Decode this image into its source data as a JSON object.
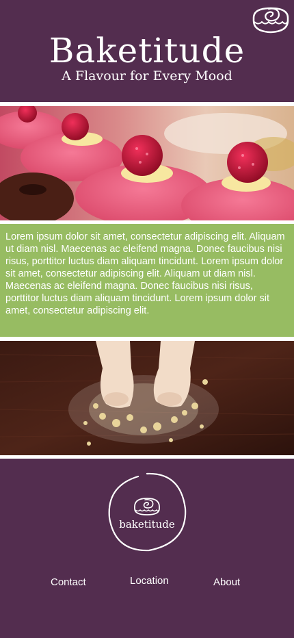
{
  "header": {
    "title": "Baketitude",
    "tagline": "A Flavour for Every Mood",
    "icon": "cinnamon-roll-icon"
  },
  "hero_image": {
    "subject": "pink-macarons-with-raspberries"
  },
  "content": {
    "text": "Lorem ipsum dolor sit amet, consectetur adipiscing elit. Aliquam ut diam nisl. Maecenas ac eleifend magna. Donec faucibus nisi risus, porttitor luctus diam aliquam tincidunt. Lorem ipsum dolor sit amet, consectetur adipiscing elit. Aliquam ut diam nisl. Maecenas ac eleifend magna. Donec faucibus nisi risus, porttitor luctus diam aliquam tincidunt. Lorem ipsum dolor sit amet, consectetur adipiscing elit."
  },
  "second_image": {
    "subject": "hands-kneading-dough"
  },
  "footer": {
    "logo_text": "baketitude",
    "logo_icon": "cinnamon-roll-icon",
    "nav": {
      "contact": "Contact",
      "location": "Location",
      "about": "About"
    }
  },
  "colors": {
    "plum": "#532d4f",
    "green": "#97bc62",
    "white": "#ffffff"
  }
}
